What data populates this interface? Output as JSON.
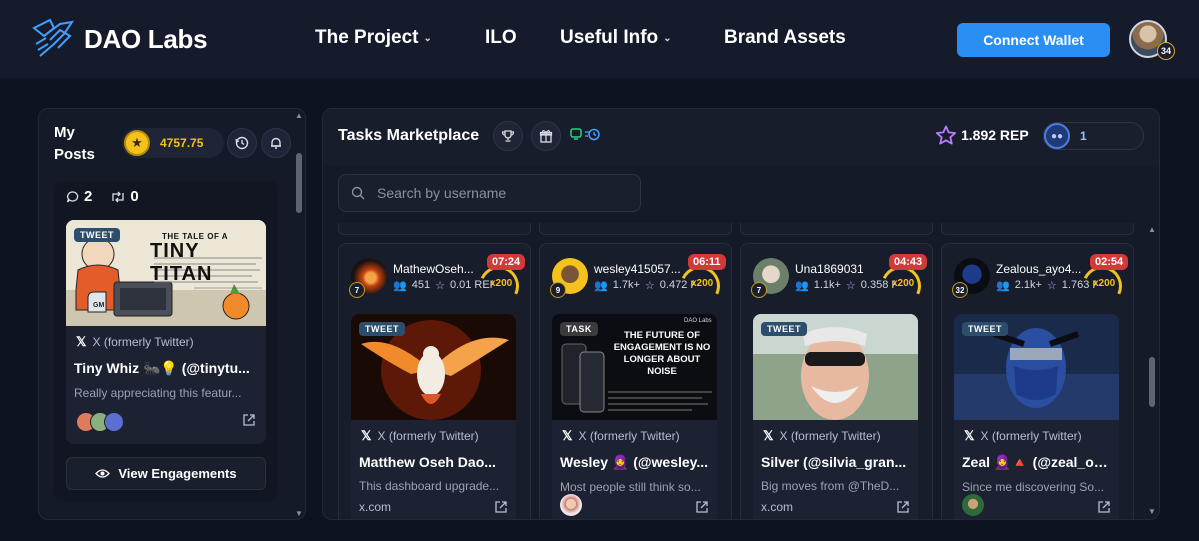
{
  "brand": {
    "name": "DAO Labs"
  },
  "nav": {
    "links": [
      {
        "label": "The Project",
        "chevron": true
      },
      {
        "label": "ILO",
        "chevron": false
      },
      {
        "label": "Useful Info",
        "chevron": true
      },
      {
        "label": "Brand Assets",
        "chevron": false
      }
    ],
    "connect_wallet": "Connect Wallet",
    "avatar_level": "34"
  },
  "left": {
    "title": "My Posts",
    "coins": "4757.75",
    "stats": {
      "comments": "2",
      "retweets": "0"
    },
    "post": {
      "tag": "TWEET",
      "image_title_small": "THE TALE OF A",
      "image_title_big": "TINY TITAN",
      "source": "X (formerly Twitter)",
      "author": "Tiny Whiz 🐜💡 (@tinytu...",
      "text": "Really appreciating this featur...",
      "mug_label": "GM"
    },
    "view_engagements": "View Engagements"
  },
  "right": {
    "title": "Tasks Marketplace",
    "rep": "1.892 REP",
    "tokens": "1",
    "search_placeholder": "Search by username",
    "cards": [
      {
        "username": "MathewOseh...",
        "level": "7",
        "followers": "451",
        "rep": "0.01 REP",
        "timer": "07:24",
        "multiplier": "x200",
        "tag": "TWEET",
        "source": "X (formerly Twitter)",
        "author": "Matthew Oseh Dao...",
        "text": "This dashboard upgrade...",
        "link": "x.com",
        "color": "#c2410c"
      },
      {
        "username": "wesley415057...",
        "level": "9",
        "followers": "1.7k+",
        "rep": "0.472 REP",
        "timer": "06:11",
        "multiplier": "x200",
        "tag": "TASK",
        "source": "X (formerly Twitter)",
        "author": "Wesley 🧕 (@wesley...",
        "text": "Most people still think so...",
        "link": "",
        "color": "#111"
      },
      {
        "username": "Una1869031",
        "level": "7",
        "followers": "1.1k+",
        "rep": "0.358 REP",
        "timer": "04:43",
        "multiplier": "x200",
        "tag": "TWEET",
        "source": "X (formerly Twitter)",
        "author": "Silver (@silvia_gran...",
        "text": "Big moves from @TheD...",
        "link": "x.com",
        "color": "#6b7f6a"
      },
      {
        "username": "Zealous_ayo4...",
        "level": "32",
        "followers": "2.1k+",
        "rep": "1.763 REP",
        "timer": "02:54",
        "multiplier": "x200",
        "tag": "TWEET",
        "source": "X (formerly Twitter)",
        "author": "Zeal 🧕🔺 (@zeal_on...",
        "text": "Since me discovering So...",
        "link": "",
        "color": "#1e3a8a"
      }
    ],
    "task_image_text": "THE FUTURE OF ENGAGEMENT IS NO LONGER ABOUT NOISE",
    "task_image_brand": "DAO Labs"
  }
}
